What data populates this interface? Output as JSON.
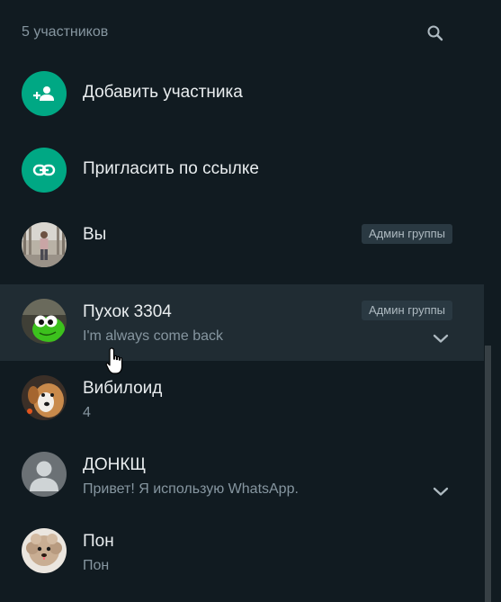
{
  "header": {
    "participant_count": "5 участников",
    "search_icon": "search-icon"
  },
  "actions": [
    {
      "label": "Добавить участника",
      "icon": "add-person-icon"
    },
    {
      "label": "Пригласить по ссылке",
      "icon": "link-icon"
    }
  ],
  "members": [
    {
      "name": "Вы",
      "status": "",
      "admin_badge": "Админ группы",
      "avatar": "photo-person-street"
    },
    {
      "name": "Пухок 3304",
      "status": "I'm always come back",
      "admin_badge": "Админ группы",
      "avatar": "photo-green-frog"
    },
    {
      "name": "Вибилоид",
      "status": "4",
      "admin_badge": "",
      "avatar": "photo-dog"
    },
    {
      "name": "ДОНКЩ",
      "status": "Привет! Я использую WhatsApp.",
      "admin_badge": "",
      "avatar": "default-user-icon"
    },
    {
      "name": "Пон",
      "status": "Пон",
      "admin_badge": "",
      "avatar": "photo-fluffy-dog"
    }
  ],
  "colors": {
    "background": "#111b21",
    "hover_row": "#202c33",
    "accent": "#00a884",
    "primary_text": "#e9edef",
    "secondary_text": "#8696a0",
    "badge_bg": "#2a3942"
  }
}
